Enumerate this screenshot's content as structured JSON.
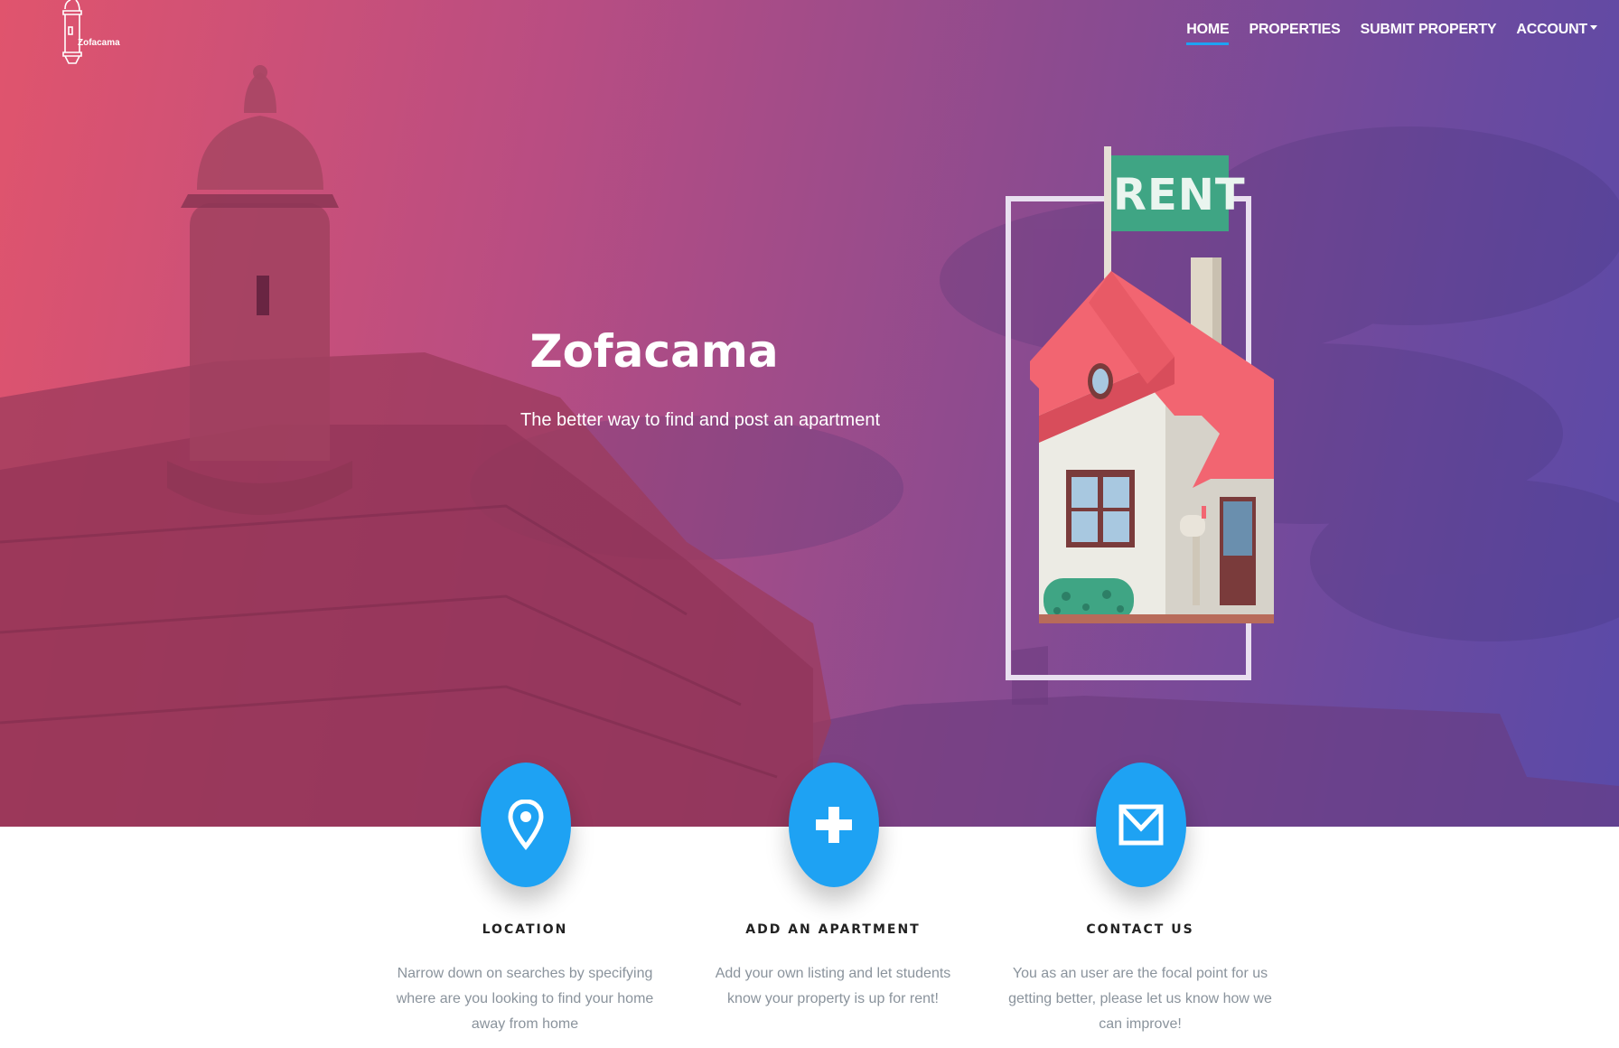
{
  "brand": {
    "logo_text": "Zofacama"
  },
  "nav": {
    "items": [
      {
        "label": "HOME",
        "active": true
      },
      {
        "label": "PROPERTIES",
        "active": false
      },
      {
        "label": "SUBMIT PROPERTY",
        "active": false
      },
      {
        "label": "ACCOUNT",
        "active": false,
        "dropdown": true
      }
    ]
  },
  "hero": {
    "title": "Zofacama",
    "subtitle": "The better way to find and post an apartment",
    "illustration": {
      "sign_text": "RENT"
    }
  },
  "features": [
    {
      "icon": "map-marker-icon",
      "title": "LOCATION",
      "text": "Narrow down on searches by specifying where are you looking to find your home away from home"
    },
    {
      "icon": "plus-icon",
      "title": "ADD AN APARTMENT",
      "text": "Add your own listing and let students know your property is up for rent!"
    },
    {
      "icon": "envelope-icon",
      "title": "CONTACT US",
      "text": "You as an user are the focal point for us getting better, please let us know how we can improve!"
    }
  ],
  "colors": {
    "accent": "#1ea2f3",
    "hero_gradient_start": "#e0546d",
    "hero_gradient_end": "#5a4aa8"
  }
}
